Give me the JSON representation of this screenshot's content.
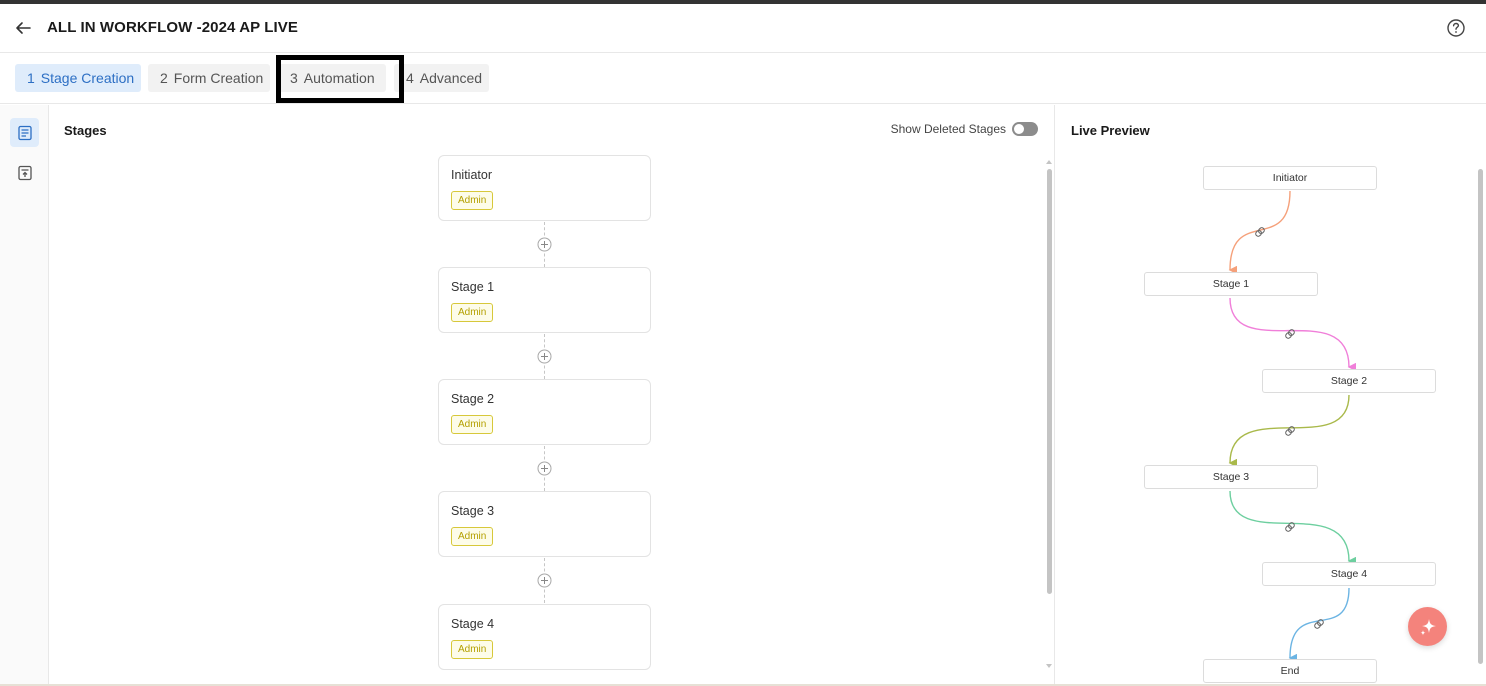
{
  "header": {
    "title": "ALL IN WORKFLOW -2024 AP LIVE",
    "back_icon": "arrow-left-icon",
    "help_icon": "help-circle-icon"
  },
  "tabs": [
    {
      "num": "1",
      "label": "Stage Creation",
      "active": true
    },
    {
      "num": "2",
      "label": "Form Creation",
      "active": false
    },
    {
      "num": "3",
      "label": "Automation",
      "active": false
    },
    {
      "num": "4",
      "label": "Advanced",
      "active": false
    }
  ],
  "rail": {
    "items": [
      "stages-list-icon",
      "form-upload-icon"
    ]
  },
  "stages_panel": {
    "title": "Stages",
    "show_deleted_label": "Show Deleted Stages",
    "show_deleted_on": false,
    "stages": [
      {
        "name": "Initiator",
        "badge": "Admin"
      },
      {
        "name": "Stage 1",
        "badge": "Admin"
      },
      {
        "name": "Stage 2",
        "badge": "Admin"
      },
      {
        "name": "Stage 3",
        "badge": "Admin"
      },
      {
        "name": "Stage 4",
        "badge": "Admin"
      }
    ]
  },
  "preview": {
    "title": "Live Preview",
    "nodes": [
      "Initiator",
      "Stage 1",
      "Stage 2",
      "Stage 3",
      "Stage 4",
      "End"
    ],
    "edge_colors": [
      "#f5a07a",
      "#f07fd9",
      "#a9b94a",
      "#6dcf9f",
      "#6bb4e3"
    ]
  },
  "colors": {
    "accent": "#2d6fc4",
    "active_tab_bg": "#dfecfb",
    "badge_border": "#d7c83a",
    "fab": "#f4837c"
  }
}
